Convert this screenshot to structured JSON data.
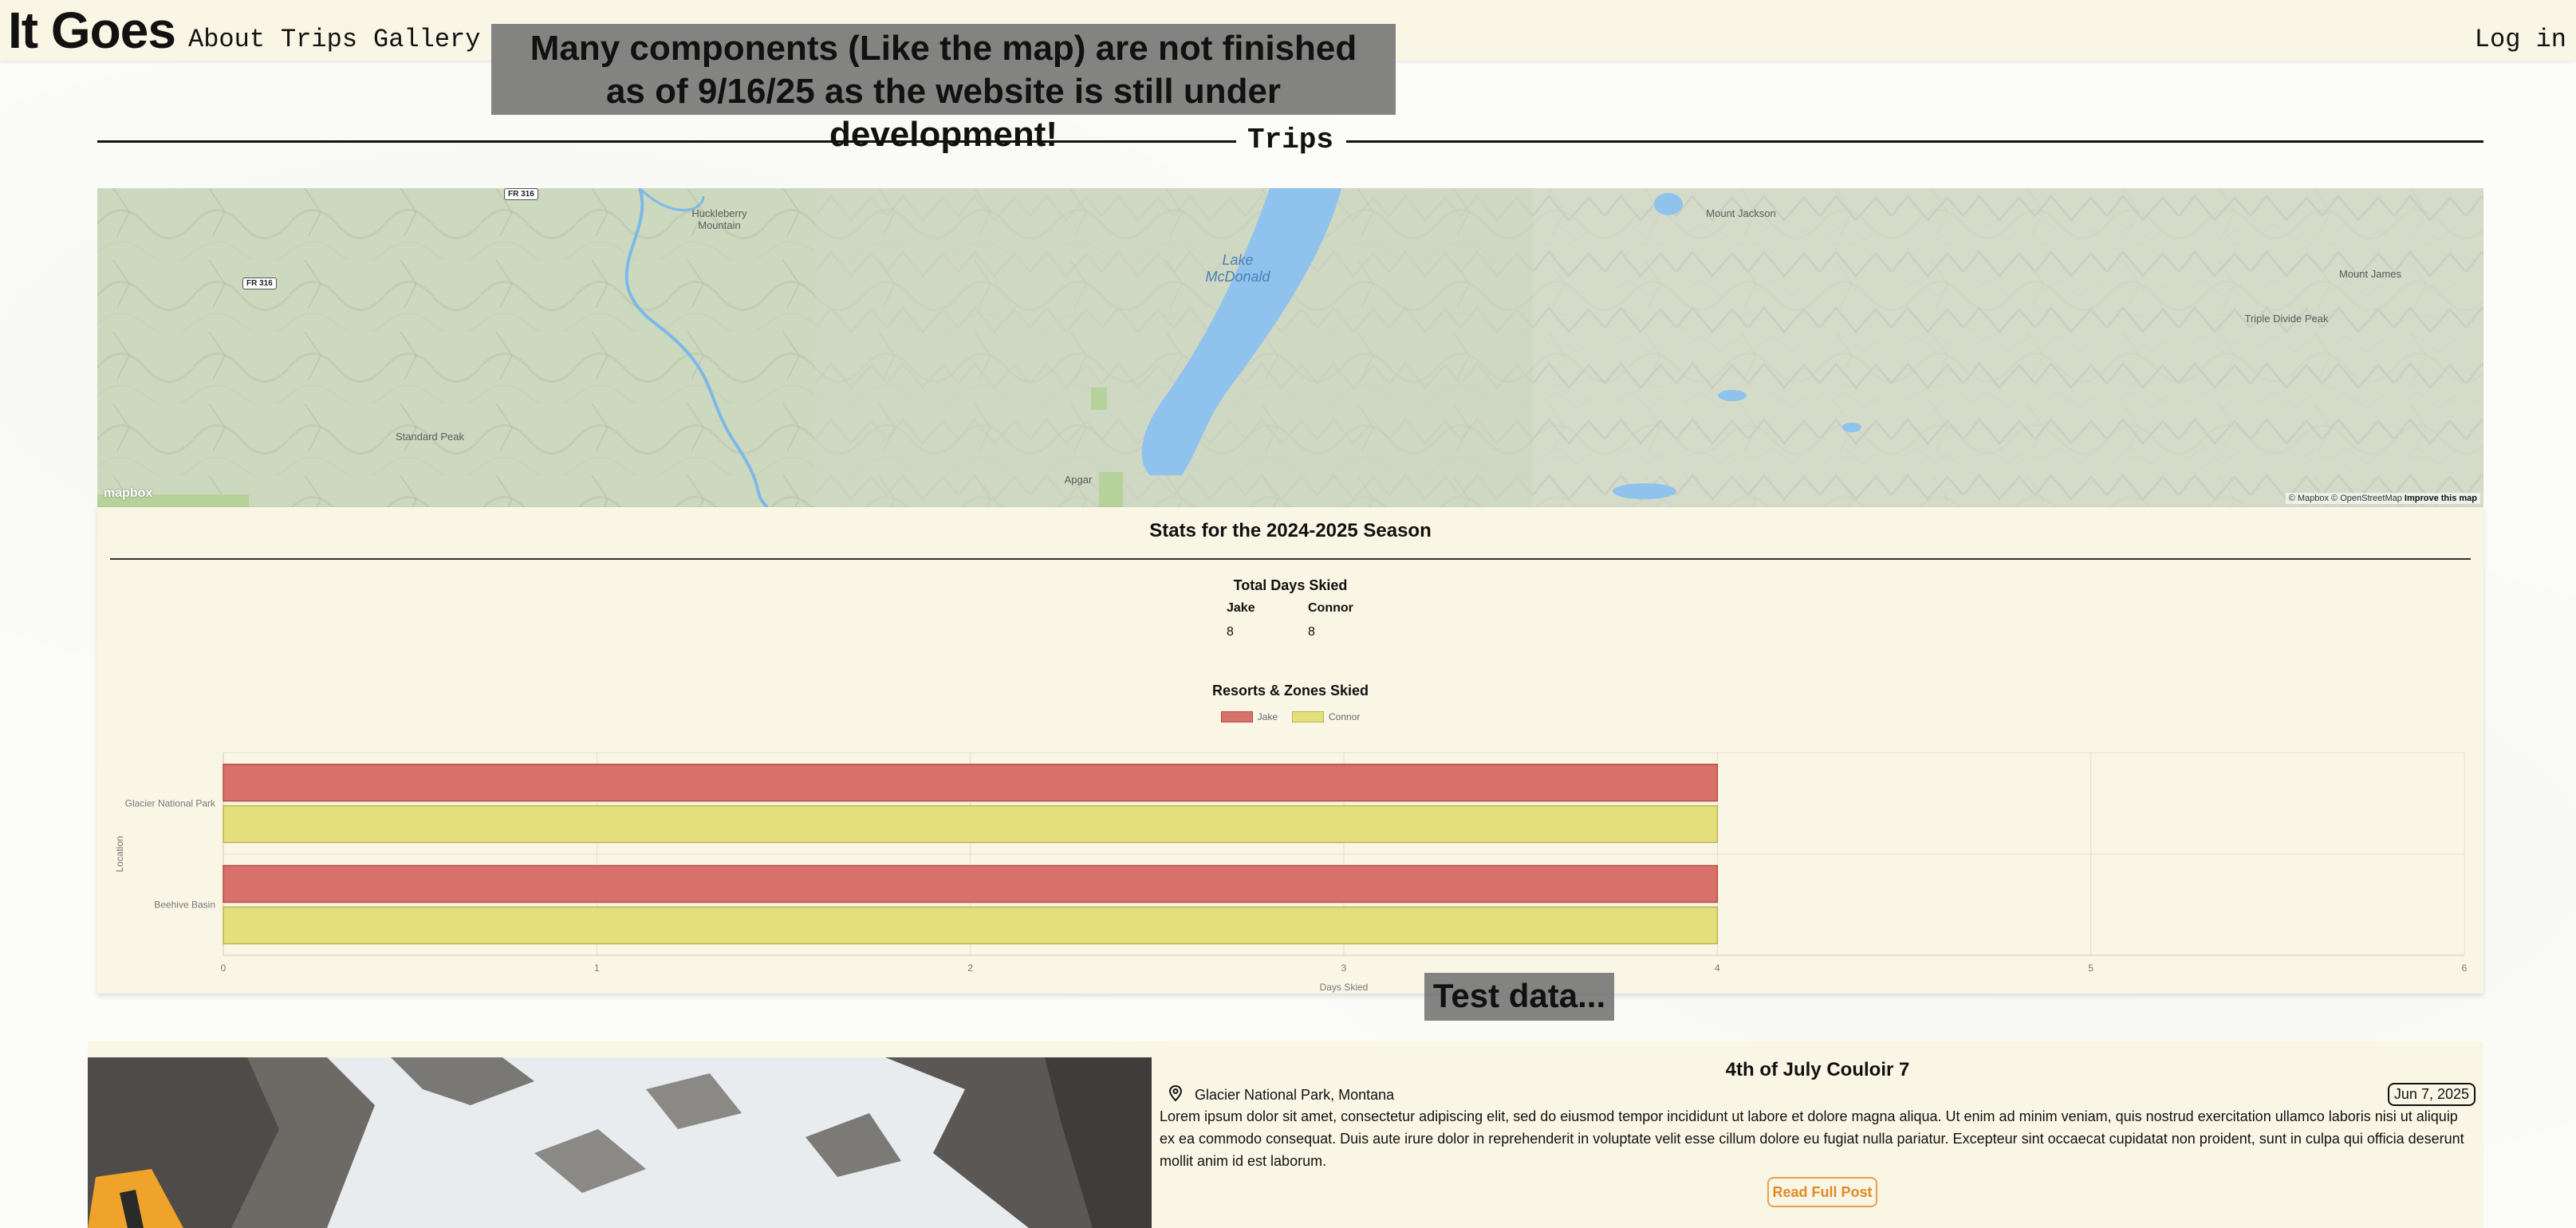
{
  "header": {
    "brand": "It Goes",
    "nav": [
      "About",
      "Trips",
      "Gallery"
    ],
    "login": "Log in"
  },
  "banner": {
    "line1": "Many components (Like the map) are not finished",
    "line2": "as of 9/16/25 as the website is still under development!"
  },
  "section_title": "Trips",
  "map": {
    "labels": {
      "huckleberry": "Huckleberry Mountain",
      "lake": "Lake McDonald",
      "jackson": "Mount Jackson",
      "james": "Mount James",
      "triple": "Triple Divide Peak",
      "standard": "Standard Peak",
      "apgar": "Apgar",
      "fr316a": "FR 316",
      "fr316b": "FR 316"
    },
    "logo": "mapbox",
    "attribution": "© Mapbox © OpenStreetMap",
    "improve": "Improve this map"
  },
  "stats": {
    "title": "Stats for the 2024-2025 Season",
    "total_title": "Total Days Skied",
    "people": [
      {
        "name": "Jake",
        "days": "8"
      },
      {
        "name": "Connor",
        "days": "8"
      }
    ]
  },
  "chart_data": {
    "type": "bar",
    "orientation": "horizontal",
    "title": "Resorts & Zones Skied",
    "categories": [
      "Glacier National Park",
      "Beehive Basin"
    ],
    "series": [
      {
        "name": "Jake",
        "values": [
          4,
          4
        ],
        "color": "#d9716b",
        "border": "#b84a44"
      },
      {
        "name": "Connor",
        "values": [
          4,
          4
        ],
        "color": "#e3df7c",
        "border": "#bdb64a"
      }
    ],
    "xlabel": "Days Skied",
    "ylabel": "Location",
    "xlim": [
      0,
      6
    ],
    "xticks": [
      "0",
      "1",
      "2",
      "3",
      "4",
      "5",
      "6"
    ],
    "legend": "top-center",
    "grid": true
  },
  "test_note": "Test data...",
  "post": {
    "title": "4th of July Couloir 7",
    "location": "Glacier National Park, Montana",
    "date": "Jun 7, 2025",
    "body": "Lorem ipsum dolor sit amet, consectetur adipiscing elit, sed do eiusmod tempor incididunt ut labore et dolore magna aliqua. Ut enim ad minim veniam, quis nostrud exercitation ullamco laboris nisi ut aliquip ex ea commodo consequat. Duis aute irure dolor in reprehenderit in voluptate velit esse cillum dolore eu fugiat nulla pariatur. Excepteur sint occaecat cupidatat non proident, sunt in culpa qui officia deserunt mollit anim id est laborum.",
    "read_more": "Read Full Post"
  },
  "colors": {
    "header_bg": "#f9f6e6",
    "accent_orange": "#e28a24"
  }
}
